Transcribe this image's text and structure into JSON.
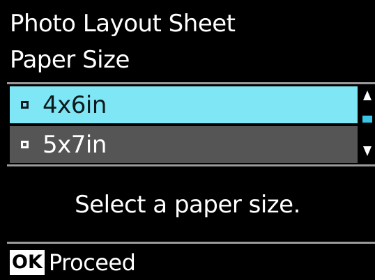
{
  "header": {
    "title": "Photo Layout Sheet",
    "subtitle": "Paper Size"
  },
  "options": [
    {
      "label": "4x6in",
      "selected": true
    },
    {
      "label": "5x7in",
      "selected": false
    }
  ],
  "message": "Select a paper size.",
  "footer": {
    "key_label": "OK",
    "action_label": "Proceed"
  },
  "colors": {
    "background": "#000000",
    "selected_row": "#7fe6f6",
    "unselected_row": "#555555",
    "scroll_thumb": "#39c6e6",
    "separator": "#9a9a9a"
  },
  "icons": {
    "scroll_up": "triangle-up-icon",
    "scroll_down": "triangle-down-icon",
    "bullet": "square-bullet-icon"
  }
}
